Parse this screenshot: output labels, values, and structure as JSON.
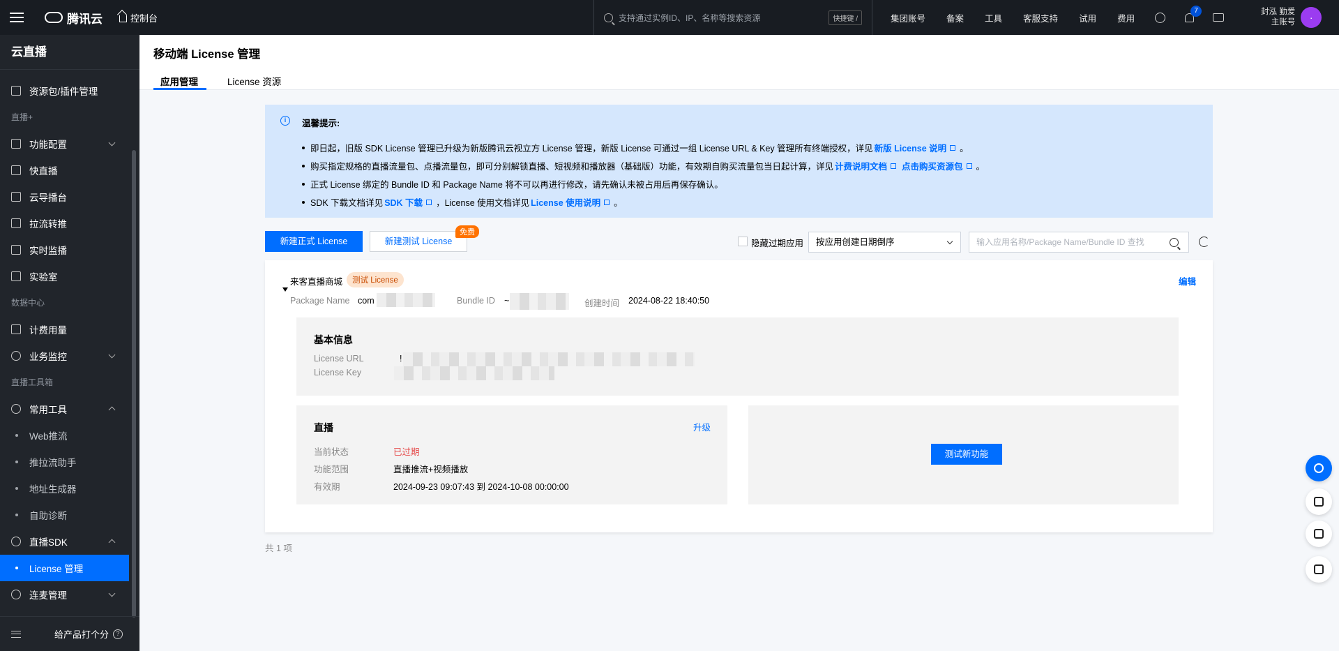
{
  "topbar": {
    "brand": "腾讯云",
    "console": "控制台",
    "search_placeholder": "支持通过实例ID、IP、名称等搜索资源",
    "shortcut": "快捷键 /",
    "nav": [
      "集团账号",
      "备案",
      "工具",
      "客服支持",
      "试用",
      "费用"
    ],
    "notification_count": "7",
    "user_name": "封泓 勤爱",
    "user_role": "主账号",
    "avatar_letter": "."
  },
  "sidebar": {
    "title": "云直播",
    "item_resource": "资源包/插件管理",
    "group_live": "直播+",
    "item_feature": "功能配置",
    "item_quick": "快直播",
    "item_director": "云导播台",
    "item_relay": "拉流转推",
    "item_monitor": "实时监播",
    "item_lab": "实验室",
    "group_data": "数据中心",
    "item_billing": "计费用量",
    "item_business": "业务监控",
    "group_tools": "直播工具箱",
    "item_common_tools": "常用工具",
    "sub_web_push": "Web推流",
    "sub_push_helper": "推拉流助手",
    "sub_url_gen": "地址生成器",
    "sub_diagnosis": "自助诊断",
    "item_sdk": "直播SDK",
    "sub_license": "License 管理",
    "item_link": "连麦管理",
    "footer_rate": "给产品打个分"
  },
  "header": {
    "title": "移动端 License 管理",
    "tab_app": "应用管理",
    "tab_license": "License 资源"
  },
  "notice": {
    "title": "温馨提示:",
    "line1": "即日起，旧版 SDK License 管理已升级为新版腾讯云视立方 License 管理，新版 License 可通过一组 License URL & Key 管理所有终端授权，详见",
    "line1_link": "新版 License 说明",
    "line2": "购买指定规格的直播流量包、点播流量包，即可分别解锁直播、短视频和播放器（基础版）功能，有效期自购买流量包当日起计算，详见",
    "line2_link1": "计费说明文档",
    "line2_link2": "点击购买资源包",
    "line3": "正式 License 绑定的 Bundle ID 和 Package Name 将不可以再进行修改，请先确认未被占用后再保存确认。",
    "line4_a": "SDK 下载文档详见",
    "line4_link1": "SDK 下载",
    "line4_b": "，License 使用文档详见",
    "line4_link2": "License 使用说明",
    "period": "。"
  },
  "toolbar": {
    "new_formal": "新建正式 License",
    "new_test": "新建测试 License",
    "free_tag": "免费",
    "hide_expired": "隐藏过期应用",
    "sort_selected": "按应用创建日期倒序",
    "search_placeholder": "输入应用名称/Package Name/Bundle ID 查找"
  },
  "card": {
    "app_name": "来客直播商城",
    "license_tag": "测试 License",
    "edit": "编辑",
    "package_label": "Package Name",
    "package_value": "com",
    "bundle_label": "Bundle ID",
    "bundle_value": "~",
    "created_label": "创建时间",
    "created_value": "2024-08-22 18:40:50",
    "basic_title": "基本信息",
    "url_label": "License URL",
    "url_value": "!",
    "key_label": "License Key",
    "live_title": "直播",
    "upgrade": "升级",
    "status_label": "当前状态",
    "status_value": "已过期",
    "scope_label": "功能范围",
    "scope_value": "直播推流+视频播放",
    "valid_label": "有效期",
    "valid_value": "2024-09-23 09:07:43 到 2024-10-08 00:00:00",
    "test_feature": "测试新功能"
  },
  "footer": {
    "total": "共 1 项"
  },
  "colors": {
    "primary": "#006eff",
    "notice_bg": "#d5e7fd",
    "expired": "#e54545",
    "free_tag": "#ff7200"
  }
}
